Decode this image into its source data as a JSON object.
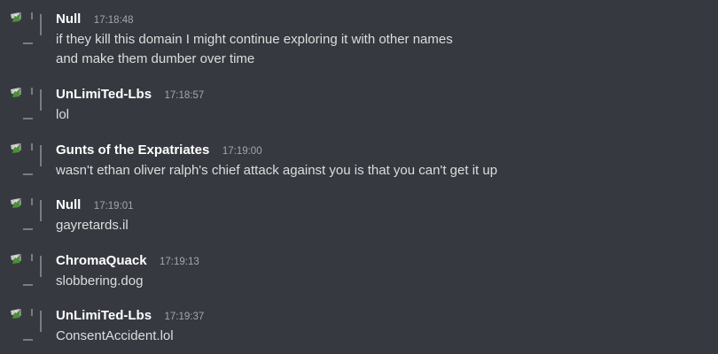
{
  "colors": {
    "background": "#36393f",
    "username": "#ffffff",
    "timestamp": "#a3a6aa",
    "message_text": "#dcddde"
  },
  "icons": {
    "avatar": "broken-image-avatar-icon"
  },
  "messages": [
    {
      "author": "Null",
      "time": "17:18:48",
      "lines": [
        "if they kill this domain I might continue exploring it with other names",
        "and make them dumber over time"
      ]
    },
    {
      "author": "UnLimiTed-Lbs",
      "time": "17:18:57",
      "lines": [
        "lol"
      ]
    },
    {
      "author": "Gunts of the Expatriates",
      "time": "17:19:00",
      "lines": [
        "wasn't ethan oliver ralph's chief attack against you is that you can't get it up"
      ]
    },
    {
      "author": "Null",
      "time": "17:19:01",
      "lines": [
        "gayretards.il"
      ]
    },
    {
      "author": "ChromaQuack",
      "time": "17:19:13",
      "lines": [
        "slobbering.dog"
      ]
    },
    {
      "author": "UnLimiTed-Lbs",
      "time": "17:19:37",
      "lines": [
        "ConsentAccident.lol"
      ]
    }
  ]
}
